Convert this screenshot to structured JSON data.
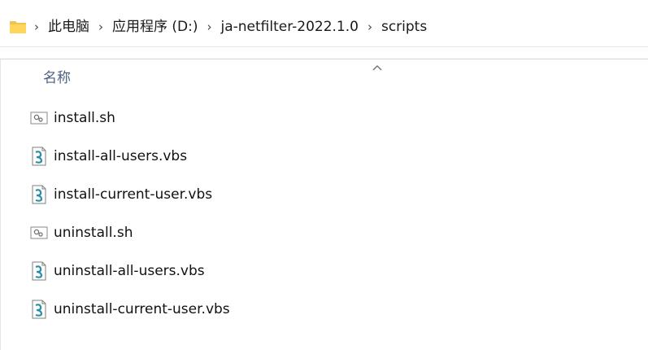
{
  "breadcrumb": {
    "items": [
      {
        "label": "此电脑"
      },
      {
        "label": "应用程序 (D:)"
      },
      {
        "label": "ja-netfilter-2022.1.0"
      },
      {
        "label": "scripts"
      }
    ]
  },
  "columns": {
    "name_header": "名称"
  },
  "files": [
    {
      "name": "install.sh",
      "icon": "shell-script-icon"
    },
    {
      "name": "install-all-users.vbs",
      "icon": "vbs-script-icon"
    },
    {
      "name": "install-current-user.vbs",
      "icon": "vbs-script-icon"
    },
    {
      "name": "uninstall.sh",
      "icon": "shell-script-icon"
    },
    {
      "name": "uninstall-all-users.vbs",
      "icon": "vbs-script-icon"
    },
    {
      "name": "uninstall-current-user.vbs",
      "icon": "vbs-script-icon"
    }
  ],
  "colors": {
    "folder": "#f2c24f",
    "header_text": "#4d6082",
    "vbs_accent": "#2a8fa3"
  }
}
